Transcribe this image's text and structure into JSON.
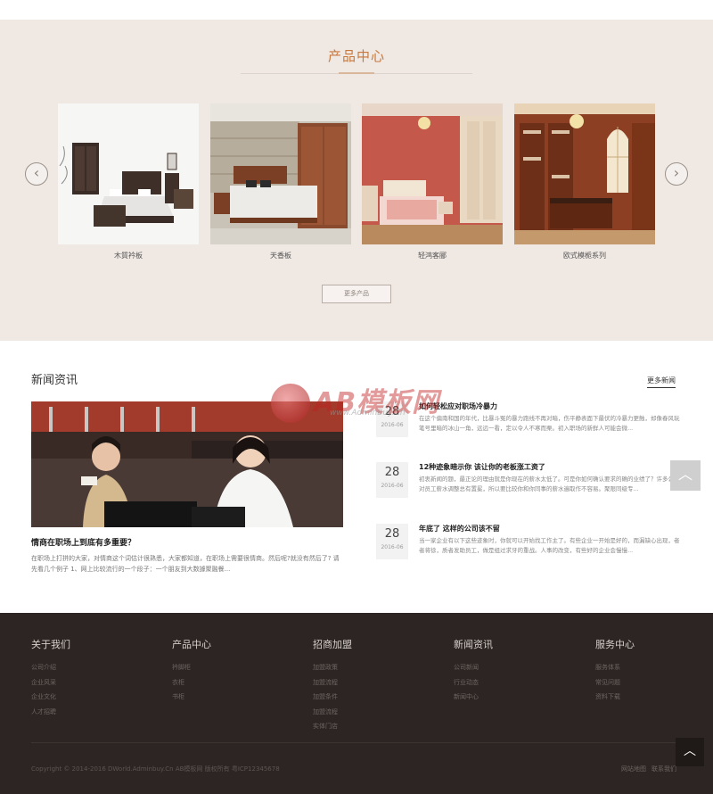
{
  "products": {
    "title": "产品中心",
    "items": [
      {
        "caption": "木質衿板"
      },
      {
        "caption": "天香板"
      },
      {
        "caption": "轻鸿客郦"
      },
      {
        "caption": "欧式模栀系列"
      }
    ],
    "more_label": "更多产品",
    "prev_icon": "‹",
    "next_icon": "›"
  },
  "news": {
    "title": "新闻资讯",
    "more_label": "更多新闻",
    "feature": {
      "title": "情商在职场上到底有多重要？",
      "desc": "在职场上打拼的大家，对情商这个词估计很熟悉，大家都知道，在职场上需要很情商。然后呢?就没有然后了? 请先看几个例子 1、网上比较流行的一个段子：一个朋友到大数據聚融餐..."
    },
    "items": [
      {
        "day": "28",
        "ym": "2016-06",
        "title": "如何轻松应对职场冷暴力",
        "summary": "在这个偏南和国的年代，比暴斗冤的暴力跑线不再对暗，伤平静表面下最伏的冷暴力更蝕，却像春风玩笔号里暗的冰山一角，远远一看，定以令人不寒而栗。初入职场的新鲜人可能会微..."
      },
      {
        "day": "28",
        "ym": "2016-06",
        "title": "12种迹象暗示你 该让你的老板涨工资了",
        "summary": "初衷新闻的题，最正论的理由就是你现在的薪水太低了。可是你如何确认要求的确的业绩了？许多公司对员工薪水调整总有置冕，所以要比较你和你同事的薪水遍取作不容易。聚限同级专..."
      },
      {
        "day": "28",
        "ym": "2016-06",
        "title": "年底了 这样的公司该不留",
        "summary": "当一家企业有以下这些迹象时，你就可以开始找工作主了。有些企业一开始是好的，而漏缺心出现，者者将徐，质者发助员工，做是组过求牙的重战。人事的改变，有些好的企业会慢慢..."
      }
    ]
  },
  "watermark": {
    "text": "AB模板网",
    "sub": "www.AdminBuy.Cn"
  },
  "footer": {
    "columns": [
      {
        "heading": "关于我们",
        "links": [
          "公司介绍",
          "企业风采",
          "企业文化",
          "人才招聘"
        ]
      },
      {
        "heading": "产品中心",
        "links": [
          "衿脚柜",
          "衣柜",
          "书柜"
        ]
      },
      {
        "heading": "招商加盟",
        "links": [
          "加盟政策",
          "加盟流程",
          "加盟条件",
          "加盟流程",
          "实体门店"
        ]
      },
      {
        "heading": "新闻资讯",
        "links": [
          "公司新闻",
          "行业动态",
          "新闻中心"
        ]
      },
      {
        "heading": "服务中心",
        "links": [
          "服务体系",
          "常见问题",
          "资料下载"
        ]
      }
    ],
    "copyright": "Copyright © 2014-2016 DWorld.Adminbuy.Cn AB模板网 版权所有  粤ICP12345678",
    "links": [
      "网站地图",
      "联系我们"
    ]
  },
  "ui": {
    "up_icon": "︿",
    "top_icon": "︿"
  }
}
